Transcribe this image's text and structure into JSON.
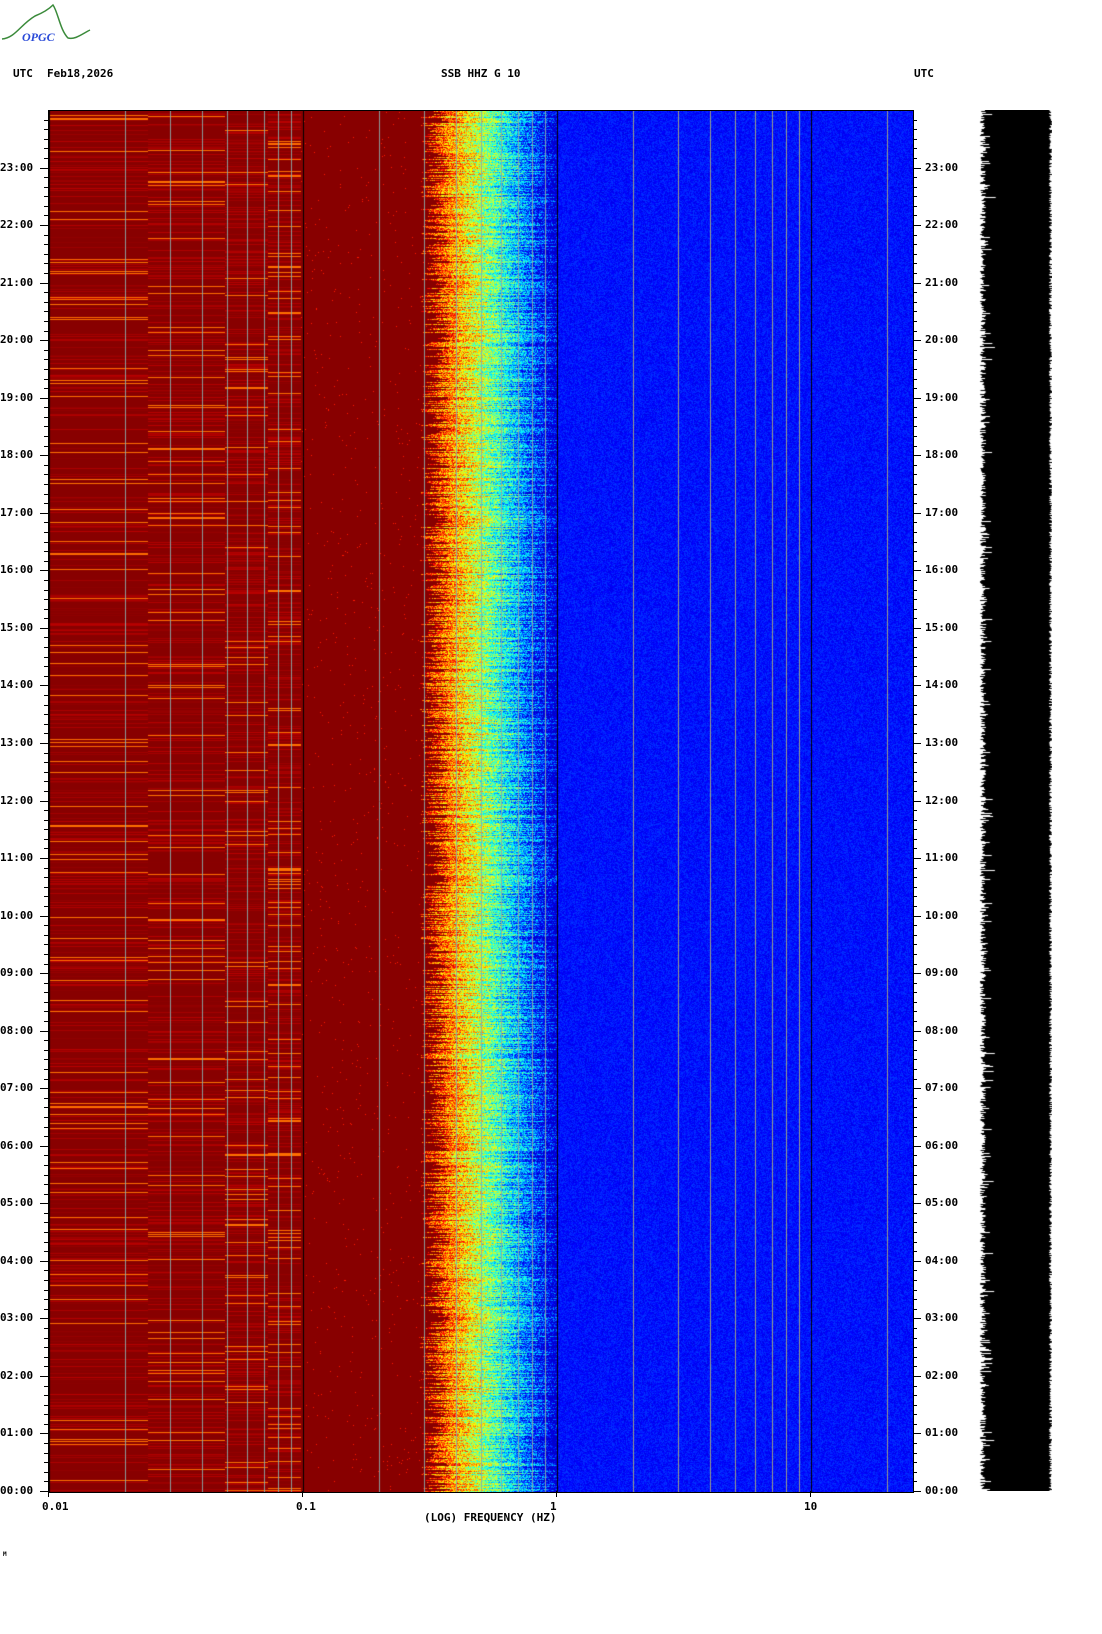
{
  "header": {
    "tz_left": "UTC",
    "date": "Feb18,2026",
    "station": "SSB HHZ G 10",
    "tz_right": "UTC"
  },
  "logo": {
    "text": "OPGC"
  },
  "footer_mark": "M",
  "chart_data": {
    "type": "heatmap",
    "title": "SSB HHZ G 10",
    "xlabel": "(LOG) FREQUENCY (HZ)",
    "xscale": "log",
    "xlim": [
      0.01,
      25
    ],
    "x_ticks": [
      "0.01",
      "0.1",
      "1",
      "10"
    ],
    "x_tick_values": [
      0.01,
      0.1,
      1,
      10
    ],
    "ylabel": "UTC",
    "ylim_hours": [
      0,
      24
    ],
    "y_ticks": [
      "23:00",
      "22:00",
      "21:00",
      "20:00",
      "19:00",
      "18:00",
      "17:00",
      "16:00",
      "15:00",
      "14:00",
      "13:00",
      "12:00",
      "11:00",
      "10:00",
      "09:00",
      "08:00",
      "07:00",
      "06:00",
      "05:00",
      "04:00",
      "03:00",
      "02:00",
      "01:00",
      "00:00"
    ],
    "colormap": "jet",
    "bands": [
      {
        "range_hz": [
          0.01,
          0.1
        ],
        "level": "high (red/yellow striped)"
      },
      {
        "range_hz": [
          0.1,
          0.35
        ],
        "level": "saturated (dark red)"
      },
      {
        "range_hz": [
          0.35,
          0.9
        ],
        "level": "transition (yellow-cyan-blue)"
      },
      {
        "range_hz": [
          0.9,
          25
        ],
        "level": "low (dark blue)"
      }
    ],
    "colors": {
      "low": "#00008c",
      "high": "#880000"
    }
  }
}
